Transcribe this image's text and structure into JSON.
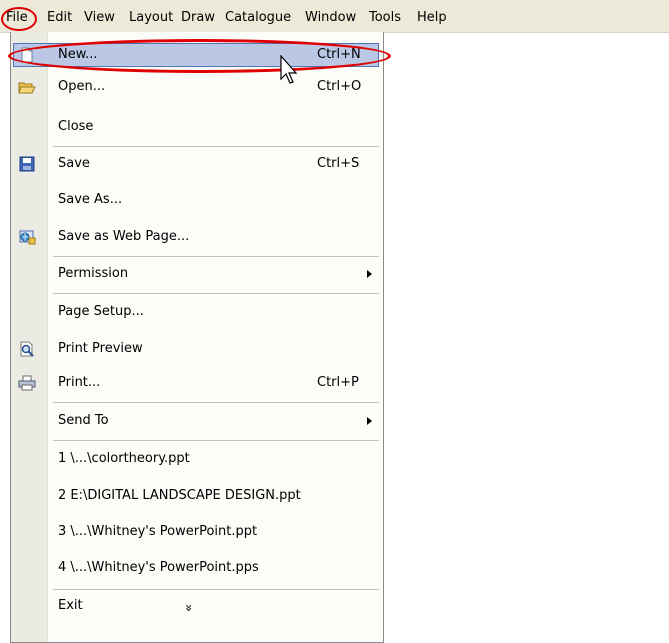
{
  "menubar": {
    "items": [
      "File",
      "Edit",
      "View",
      "Layout",
      "Draw",
      "Catalogue",
      "Window",
      "Tools",
      "Help"
    ]
  },
  "file_menu": {
    "new": {
      "label": "New...",
      "shortcut": "Ctrl+N",
      "icon": "new-document-icon"
    },
    "open": {
      "label": "Open...",
      "shortcut": "Ctrl+O",
      "icon": "open-folder-icon"
    },
    "close": {
      "label": "Close"
    },
    "save": {
      "label": "Save",
      "shortcut": "Ctrl+S",
      "icon": "save-disk-icon"
    },
    "save_as": {
      "label": "Save As..."
    },
    "save_web": {
      "label": "Save as Web Page...",
      "icon": "web-page-icon"
    },
    "permission": {
      "label": "Permission"
    },
    "page_setup": {
      "label": "Page Setup..."
    },
    "print_preview": {
      "label": "Print Preview",
      "icon": "print-preview-icon"
    },
    "print": {
      "label": "Print...",
      "shortcut": "Ctrl+P",
      "icon": "printer-icon"
    },
    "send_to": {
      "label": "Send To"
    },
    "recent": [
      "1 \\...\\colortheory.ppt",
      "2 E:\\DIGITAL LANDSCAPE DESIGN.ppt",
      "3 \\...\\Whitney's PowerPoint.ppt",
      "4 \\...\\Whitney's PowerPoint.pps"
    ],
    "exit": {
      "label": "Exit"
    },
    "expand_glyph": "»"
  },
  "colors": {
    "highlight_fill": "#bac8e6",
    "highlight_border": "#5074b6",
    "annotation_red": "#e00000",
    "menubar_bg": "#ece9d8"
  }
}
